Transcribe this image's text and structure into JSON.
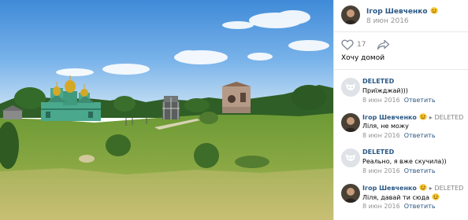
{
  "post": {
    "author": "Ігор Шевченко",
    "date": "8 июн 2016",
    "like_count": "17",
    "caption": "Хочу домой"
  },
  "comments": [
    {
      "author": "DELETED",
      "reply_to": "",
      "text": "Приїжджай)))",
      "date": "8 июн 2016",
      "action": "Ответить",
      "avatar": "deleted"
    },
    {
      "author": "Ігор Шевченко",
      "reply_to": "DELETED",
      "text": "Ліля, не можу",
      "date": "8 июн 2016",
      "action": "Ответить",
      "avatar": "user"
    },
    {
      "author": "DELETED",
      "reply_to": "",
      "text": "Реально, я вже скучила))",
      "date": "8 июн 2016",
      "action": "Ответить",
      "avatar": "deleted"
    },
    {
      "author": "Ігор Шевченко",
      "reply_to": "DELETED",
      "text": "Ліля, давай ти сюда",
      "date": "8 июн 2016",
      "action": "Ответить",
      "avatar": "user"
    }
  ],
  "icons": {
    "like": "heart-outline-icon",
    "share": "share-arrow-icon",
    "emoji": "smiling-face-emoji"
  },
  "colors": {
    "link": "#2a5885",
    "meta": "#939393",
    "divider": "#e7e8ec"
  }
}
